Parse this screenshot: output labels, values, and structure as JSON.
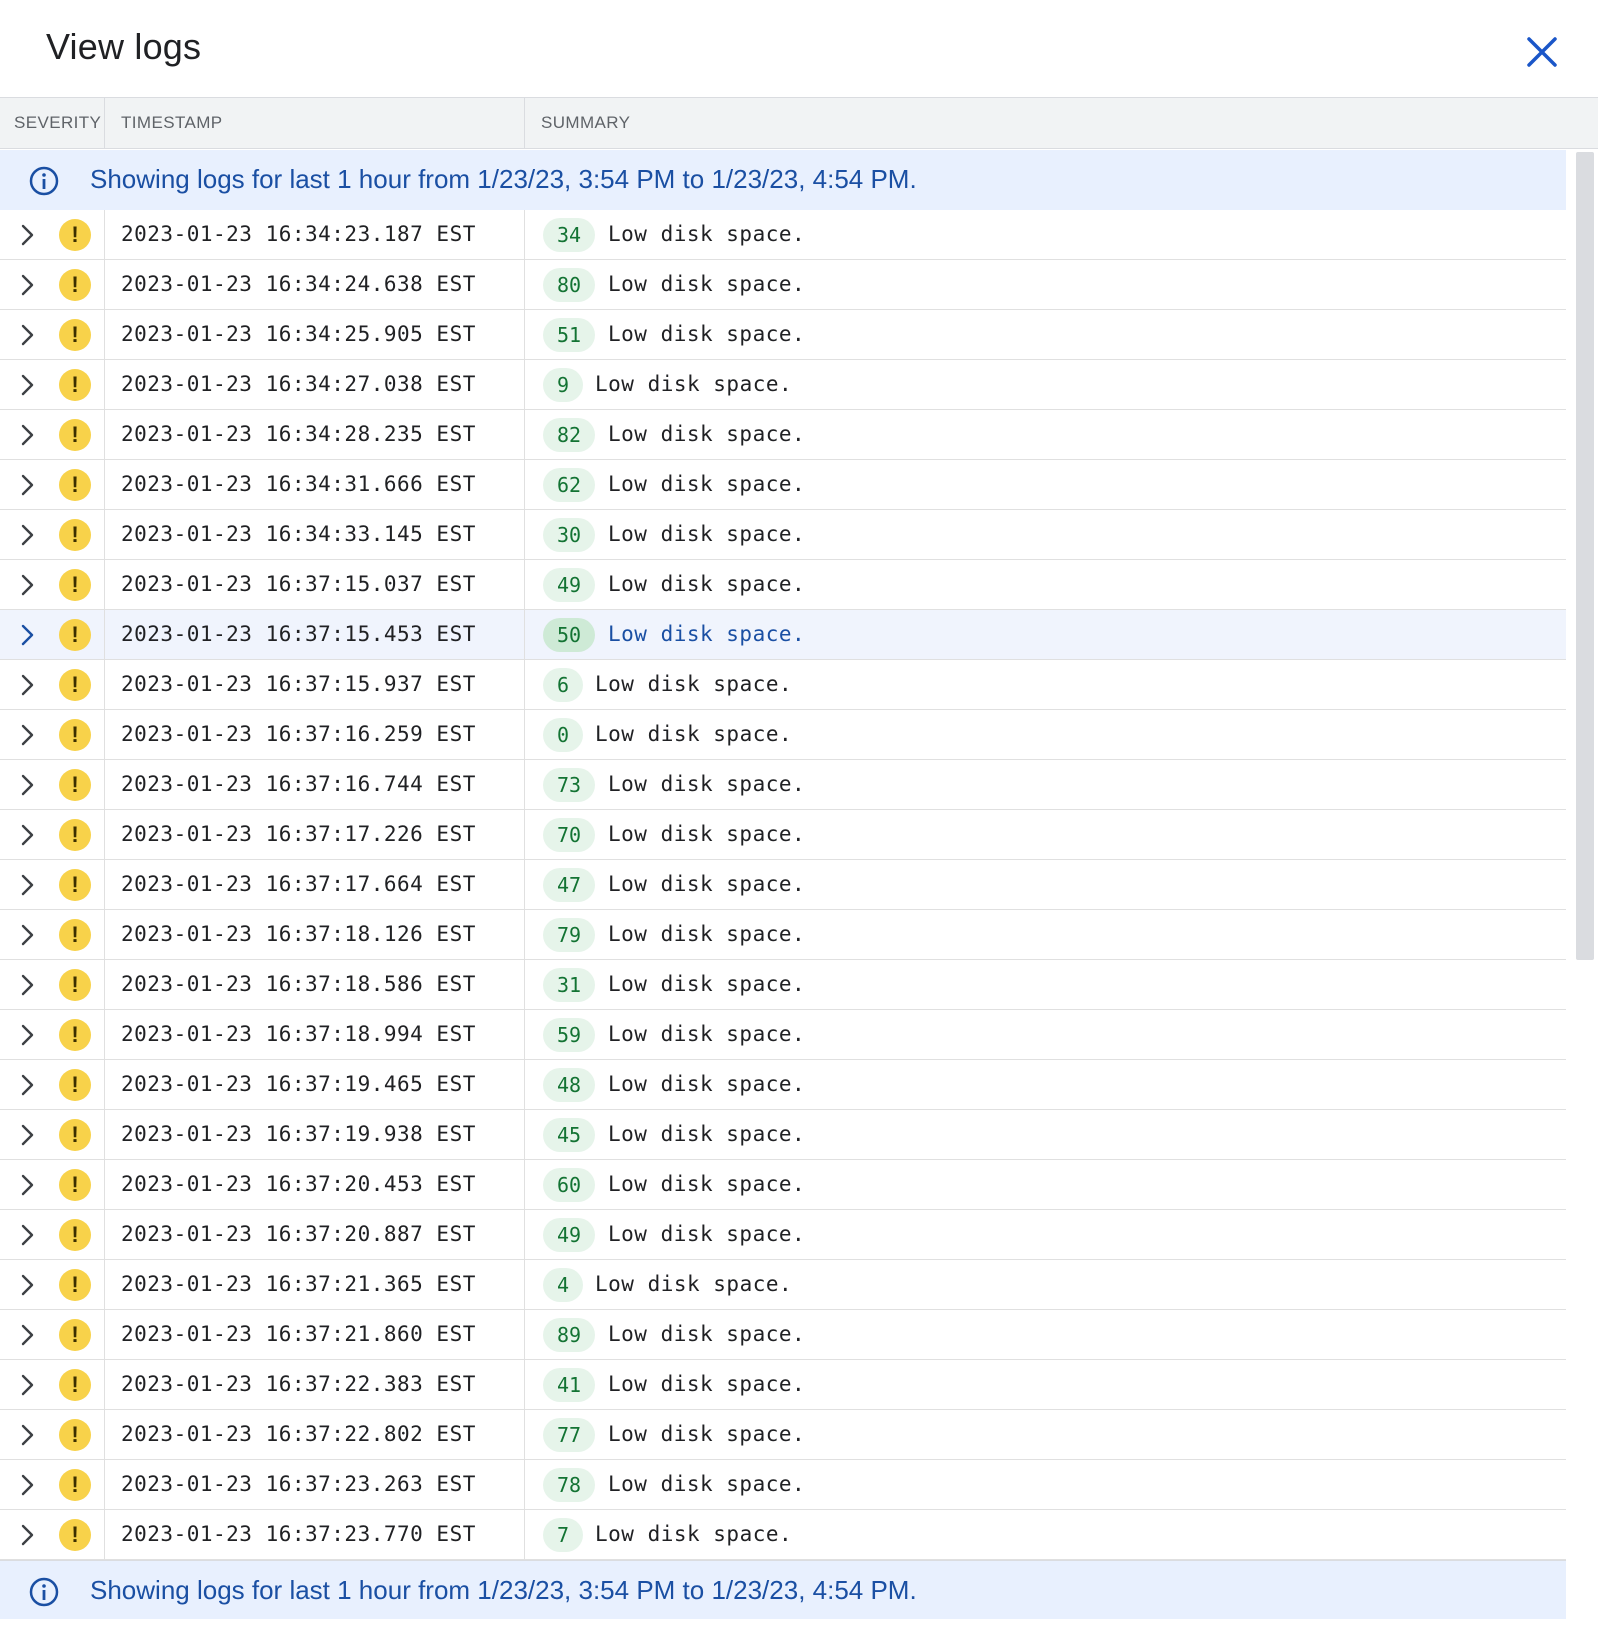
{
  "header": {
    "title": "View logs"
  },
  "columns": {
    "severity": "SEVERITY",
    "timestamp": "TIMESTAMP",
    "summary": "SUMMARY"
  },
  "banner": {
    "text": "Showing logs for last 1 hour from 1/23/23, 3:54 PM to 1/23/23, 4:54 PM."
  },
  "colors": {
    "accent": "#1a4fa3",
    "warning": "#f8d24a",
    "badge_bg": "#e6f4ea",
    "badge_text": "#137333"
  },
  "rows": [
    {
      "timestamp": "2023-01-23 16:34:23.187 EST",
      "badge": "34",
      "message": "Low disk space."
    },
    {
      "timestamp": "2023-01-23 16:34:24.638 EST",
      "badge": "80",
      "message": "Low disk space."
    },
    {
      "timestamp": "2023-01-23 16:34:25.905 EST",
      "badge": "51",
      "message": "Low disk space."
    },
    {
      "timestamp": "2023-01-23 16:34:27.038 EST",
      "badge": "9",
      "message": "Low disk space."
    },
    {
      "timestamp": "2023-01-23 16:34:28.235 EST",
      "badge": "82",
      "message": "Low disk space."
    },
    {
      "timestamp": "2023-01-23 16:34:31.666 EST",
      "badge": "62",
      "message": "Low disk space."
    },
    {
      "timestamp": "2023-01-23 16:34:33.145 EST",
      "badge": "30",
      "message": "Low disk space."
    },
    {
      "timestamp": "2023-01-23 16:37:15.037 EST",
      "badge": "49",
      "message": "Low disk space."
    },
    {
      "timestamp": "2023-01-23 16:37:15.453 EST",
      "badge": "50",
      "message": "Low disk space.",
      "selected": true
    },
    {
      "timestamp": "2023-01-23 16:37:15.937 EST",
      "badge": "6",
      "message": "Low disk space."
    },
    {
      "timestamp": "2023-01-23 16:37:16.259 EST",
      "badge": "0",
      "message": "Low disk space."
    },
    {
      "timestamp": "2023-01-23 16:37:16.744 EST",
      "badge": "73",
      "message": "Low disk space."
    },
    {
      "timestamp": "2023-01-23 16:37:17.226 EST",
      "badge": "70",
      "message": "Low disk space."
    },
    {
      "timestamp": "2023-01-23 16:37:17.664 EST",
      "badge": "47",
      "message": "Low disk space."
    },
    {
      "timestamp": "2023-01-23 16:37:18.126 EST",
      "badge": "79",
      "message": "Low disk space."
    },
    {
      "timestamp": "2023-01-23 16:37:18.586 EST",
      "badge": "31",
      "message": "Low disk space."
    },
    {
      "timestamp": "2023-01-23 16:37:18.994 EST",
      "badge": "59",
      "message": "Low disk space."
    },
    {
      "timestamp": "2023-01-23 16:37:19.465 EST",
      "badge": "48",
      "message": "Low disk space."
    },
    {
      "timestamp": "2023-01-23 16:37:19.938 EST",
      "badge": "45",
      "message": "Low disk space."
    },
    {
      "timestamp": "2023-01-23 16:37:20.453 EST",
      "badge": "60",
      "message": "Low disk space."
    },
    {
      "timestamp": "2023-01-23 16:37:20.887 EST",
      "badge": "49",
      "message": "Low disk space."
    },
    {
      "timestamp": "2023-01-23 16:37:21.365 EST",
      "badge": "4",
      "message": "Low disk space."
    },
    {
      "timestamp": "2023-01-23 16:37:21.860 EST",
      "badge": "89",
      "message": "Low disk space."
    },
    {
      "timestamp": "2023-01-23 16:37:22.383 EST",
      "badge": "41",
      "message": "Low disk space."
    },
    {
      "timestamp": "2023-01-23 16:37:22.802 EST",
      "badge": "77",
      "message": "Low disk space."
    },
    {
      "timestamp": "2023-01-23 16:37:23.263 EST",
      "badge": "78",
      "message": "Low disk space."
    },
    {
      "timestamp": "2023-01-23 16:37:23.770 EST",
      "badge": "7",
      "message": "Low disk space."
    }
  ],
  "icons": {
    "close": "close-icon",
    "info": "info-icon",
    "expand": "chevron-right-icon",
    "severity": "warning-icon"
  }
}
